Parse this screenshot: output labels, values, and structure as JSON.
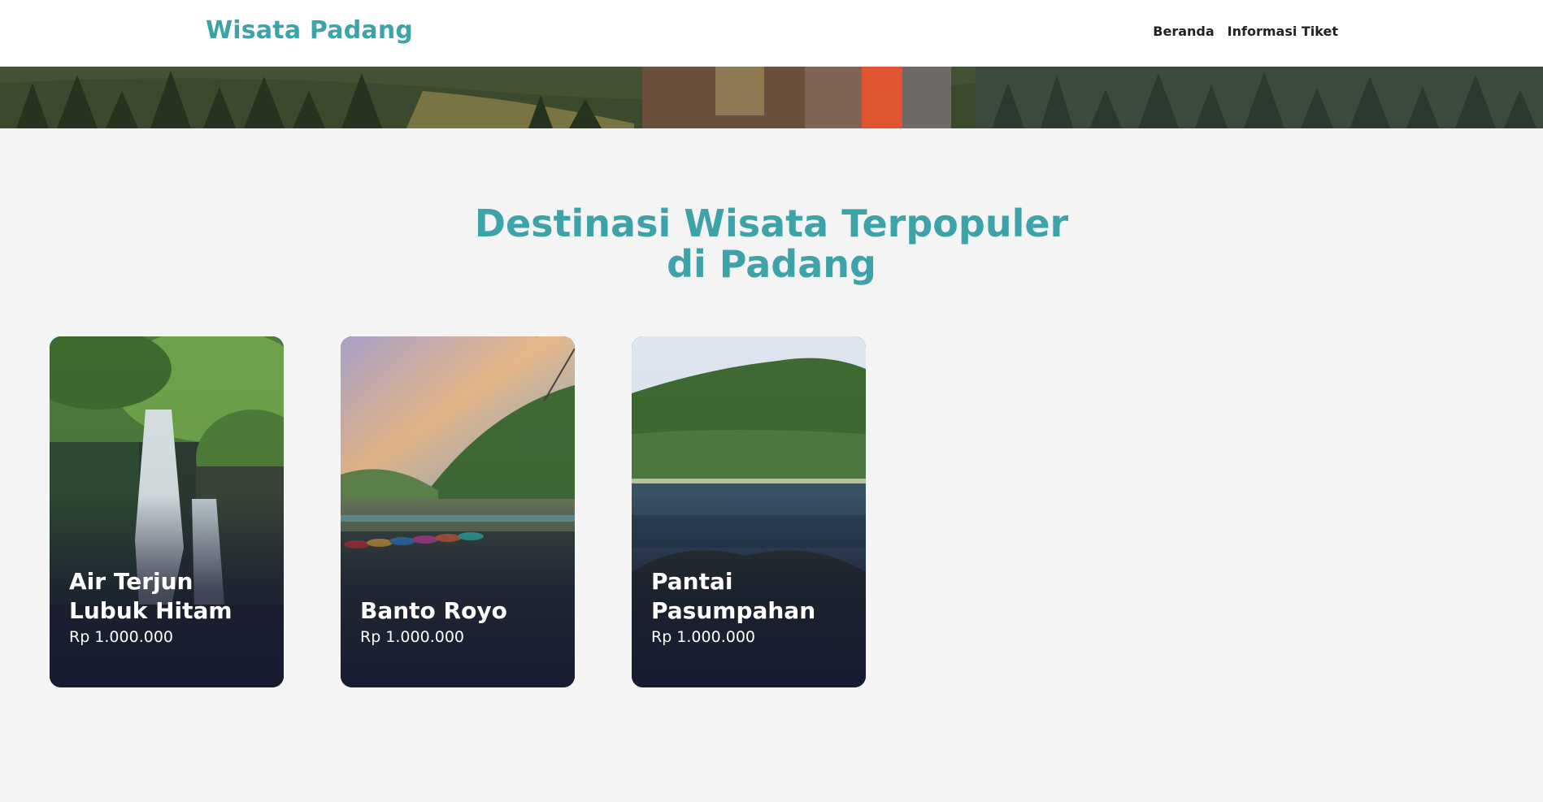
{
  "navbar": {
    "brand": "Wisata Padang",
    "links": [
      {
        "label": "Beranda"
      },
      {
        "label": "Informasi Tiket"
      }
    ]
  },
  "section": {
    "title_line1": "Destinasi Wisata Terpopuler",
    "title_line2": "di Padang"
  },
  "destinations": [
    {
      "name": "Air Terjun Lubuk Hitam",
      "price": "Rp 1.000.000"
    },
    {
      "name": "Banto Royo",
      "price": "Rp 1.000.000"
    },
    {
      "name": "Pantai Pasumpahan",
      "price": "Rp 1.000.000"
    }
  ],
  "colors": {
    "accent": "#3ea3a8",
    "page_background": "#f4f4f4",
    "card_overlay": "#161a30"
  }
}
